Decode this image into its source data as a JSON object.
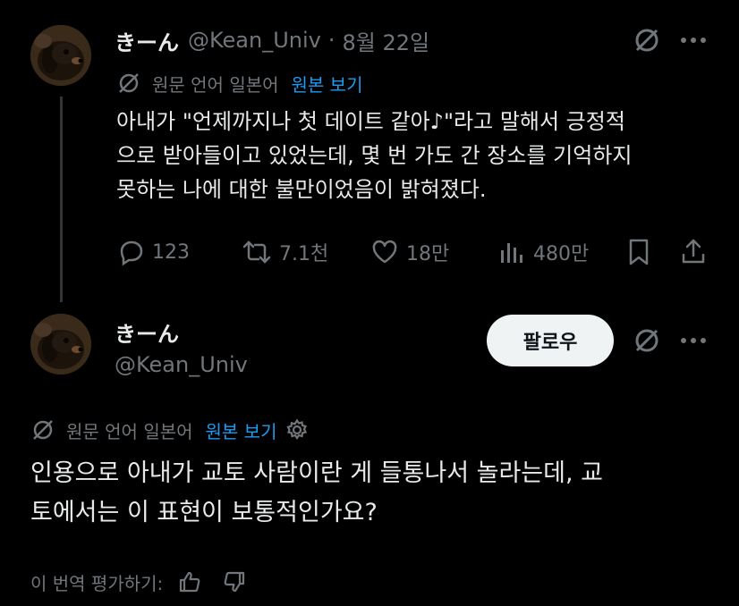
{
  "colors": {
    "background": "#000000",
    "text": "#e7e9ea",
    "secondary": "#71767b",
    "link": "#1d9bf0",
    "follow_bg": "#eff3f4"
  },
  "reply_tweet": {
    "display_name": "きーん",
    "handle": "@Kean_Univ",
    "separator": "·",
    "date": "8월 22일",
    "translation_source": "원문 언어 일본어",
    "show_original": "원본 보기",
    "text_line1": "아내가 \"언제까지나 첫 데이트 같아♪\"라고 말해서 긍정적",
    "text_line2": "으로 받아들이고 있었는데, 몇 번 가도 간 장소를 기억하지",
    "text_line3": "못하는 나에 대한 불만이었음이 밝혀졌다.",
    "actions": {
      "replies": "123",
      "retweets": "7.1천",
      "likes": "18만",
      "views": "480만"
    },
    "icons": [
      "grok-icon",
      "more-icon",
      "translate-icon",
      "reply-icon",
      "retweet-icon",
      "like-icon",
      "views-icon",
      "bookmark-icon",
      "share-icon"
    ]
  },
  "main_tweet": {
    "display_name": "きーん",
    "handle": "@Kean_Univ",
    "follow_label": "팔로우",
    "translation_source": "원문 언어 일본어",
    "show_original": "원본 보기",
    "text_line1": "인용으로 아내가 교토 사람이란 게 들통나서 놀라는데, 교",
    "text_line2": "토에서는 이 표현이 보통적인가요?",
    "rate_translation": "이 번역 평가하기:",
    "icons": [
      "grok-icon",
      "more-icon",
      "translate-icon",
      "settings-icon",
      "thumbs-up-icon",
      "thumbs-down-icon"
    ]
  }
}
